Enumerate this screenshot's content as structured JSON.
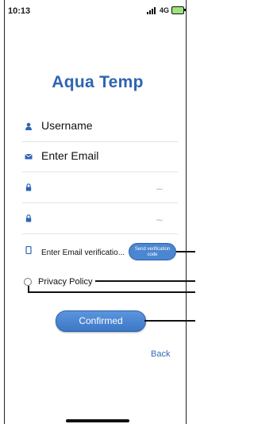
{
  "status": {
    "time": "10:13",
    "network": "4G"
  },
  "app": {
    "title": "Aqua Temp"
  },
  "form": {
    "username_label": "Username",
    "email_label": "Enter Email",
    "password_value": "",
    "confirm_password_value": "",
    "verification_label": "Enter Email verificatio...",
    "send_code_line1": "Send verification",
    "send_code_line2": "code"
  },
  "privacy": {
    "label": "Privacy Policy",
    "checked": false
  },
  "buttons": {
    "confirm": "Confirmed",
    "back": "Back"
  },
  "colors": {
    "accent": "#2f64b3",
    "button": "#4b86d1"
  },
  "icons": [
    "person-icon",
    "mail-icon",
    "lock-icon",
    "lock-icon",
    "phone-icon",
    "eye-off-icon"
  ]
}
